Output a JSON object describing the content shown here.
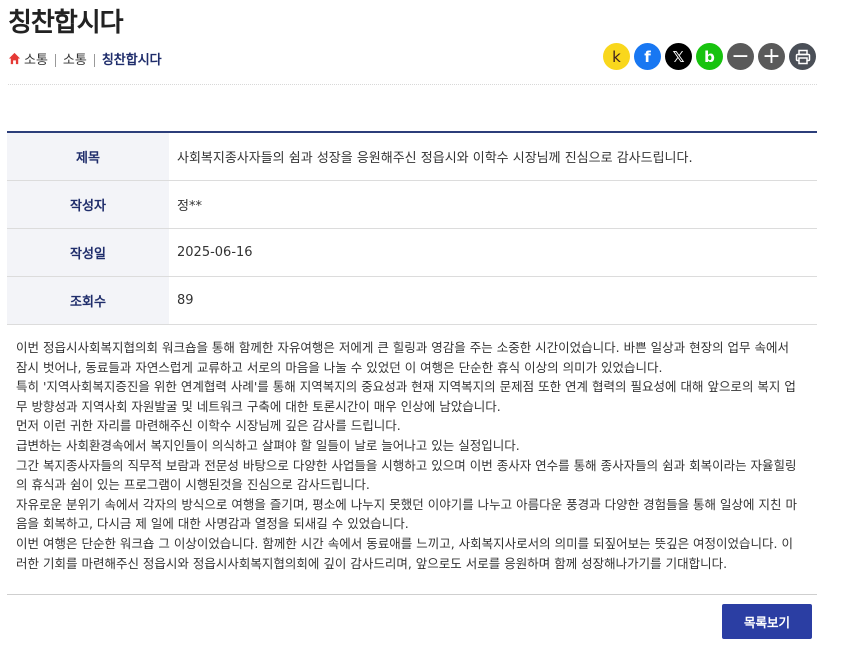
{
  "page": {
    "title": "칭찬합시다"
  },
  "breadcrumb": {
    "items": [
      "소통",
      "소통"
    ],
    "current": "칭찬합시다"
  },
  "share": {
    "kakao": "k",
    "facebook": "f",
    "x": "𝕏",
    "band": "b",
    "minus": "−",
    "plus": "+"
  },
  "post": {
    "labels": {
      "title": "제목",
      "author": "작성자",
      "date": "작성일",
      "views": "조회수"
    },
    "title": "사회복지종사자들의 쉼과 성장을 응원해주신 정읍시와 이학수 시장님께 진심으로 감사드립니다.",
    "author": "정**",
    "date": "2025-06-16",
    "views": "89",
    "body": [
      "이번 정읍시사회복지협의회 워크숍을 통해 함께한 자유여행은 저에게 큰 힐링과 영감을 주는 소중한 시간이었습니다. 바쁜 일상과 현장의 업무 속에서 잠시 벗어나, 동료들과 자연스럽게 교류하고 서로의 마음을 나눌 수 있었던 이 여행은 단순한 휴식 이상의 의미가 있었습니다.",
      "특히 '지역사회복지증진을 위한 연계협력 사례'를 통해 지역복지의 중요성과 현재 지역복지의 문제점 또한 연계 협력의 필요성에 대해 앞으로의 복지 업무 방향성과 지역사회 자원발굴 및 네트워크 구축에 대한 토론시간이 매우 인상에 남았습니다.",
      "먼저 이런 귀한 자리를 마련해주신 이학수 시장님께 깊은 감사를 드립니다.",
      "급변하는 사회환경속에서 복지인들이 의식하고 살펴야 할 일들이 날로 늘어나고 있는 실정입니다.",
      "그간 복지종사자들의 직무적 보람과 전문성 바탕으로 다양한 사업들을 시행하고 있으며 이번 종사자 연수를 통해 종사자들의 쉼과 회복이라는 자율힐링의 휴식과 쉼이 있는 프로그램이 시행된것을 진심으로 감사드립니다.",
      "자유로운 분위기 속에서 각자의 방식으로 여행을 즐기며, 평소에 나누지 못했던 이야기를 나누고 아름다운 풍경과 다양한 경험들을 통해 일상에 지친 마음을 회복하고, 다시금 제 일에 대한 사명감과 열정을 되새길 수 있었습니다.",
      "이번 여행은 단순한 워크숍 그 이상이었습니다. 함께한 시간 속에서 동료애를 느끼고, 사회복지사로서의 의미를 되짚어보는 뜻깊은 여정이었습니다. 이러한 기회를 마련해주신 정읍시와 정읍시사회복지협의회에 깊이 감사드리며, 앞으로도 서로를 응원하며 함께 성장해나가기를 기대합니다."
    ]
  },
  "actions": {
    "list_label": "목록보기"
  }
}
